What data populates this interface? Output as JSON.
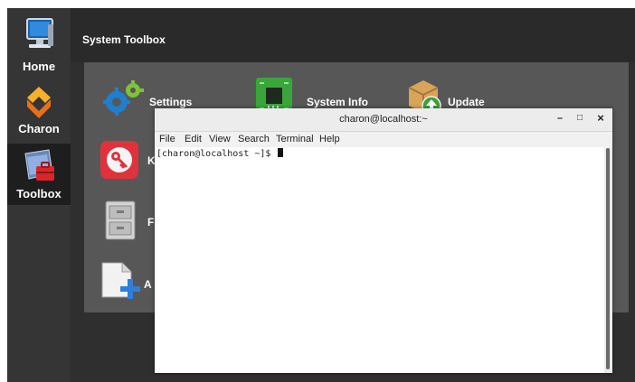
{
  "sidebar": {
    "items": [
      {
        "label": "Home",
        "icon": "monitor-icon"
      },
      {
        "label": "Charon",
        "icon": "charon-logo-icon"
      },
      {
        "label": "Toolbox",
        "icon": "toolbox-icon",
        "active": true
      }
    ]
  },
  "header": {
    "title": "System Toolbox"
  },
  "tools": [
    {
      "label": "Settings",
      "icon": "gears-icon"
    },
    {
      "label": "System Info",
      "icon": "circuit-board-icon"
    },
    {
      "label": "Update",
      "icon": "package-update-icon"
    },
    {
      "label": "K",
      "icon": "key-icon"
    },
    {
      "label": "F",
      "icon": "filing-cabinet-icon"
    },
    {
      "label": "A",
      "icon": "add-document-icon"
    }
  ],
  "terminal": {
    "title": "charon@localhost:~",
    "minimize": "–",
    "maximize": "□",
    "close": "×",
    "menu": [
      "File",
      "Edit",
      "View",
      "Search",
      "Terminal",
      "Help"
    ],
    "prompt": "[charon@localhost ~]$ "
  },
  "colors": {
    "app_bg": "#2f2f2f",
    "sidebar_bg": "#353535",
    "active_bg": "#1e1e1e",
    "panel_bg": "#575757",
    "charon_orange": "#f08a1c",
    "key_red": "#e0323c"
  }
}
